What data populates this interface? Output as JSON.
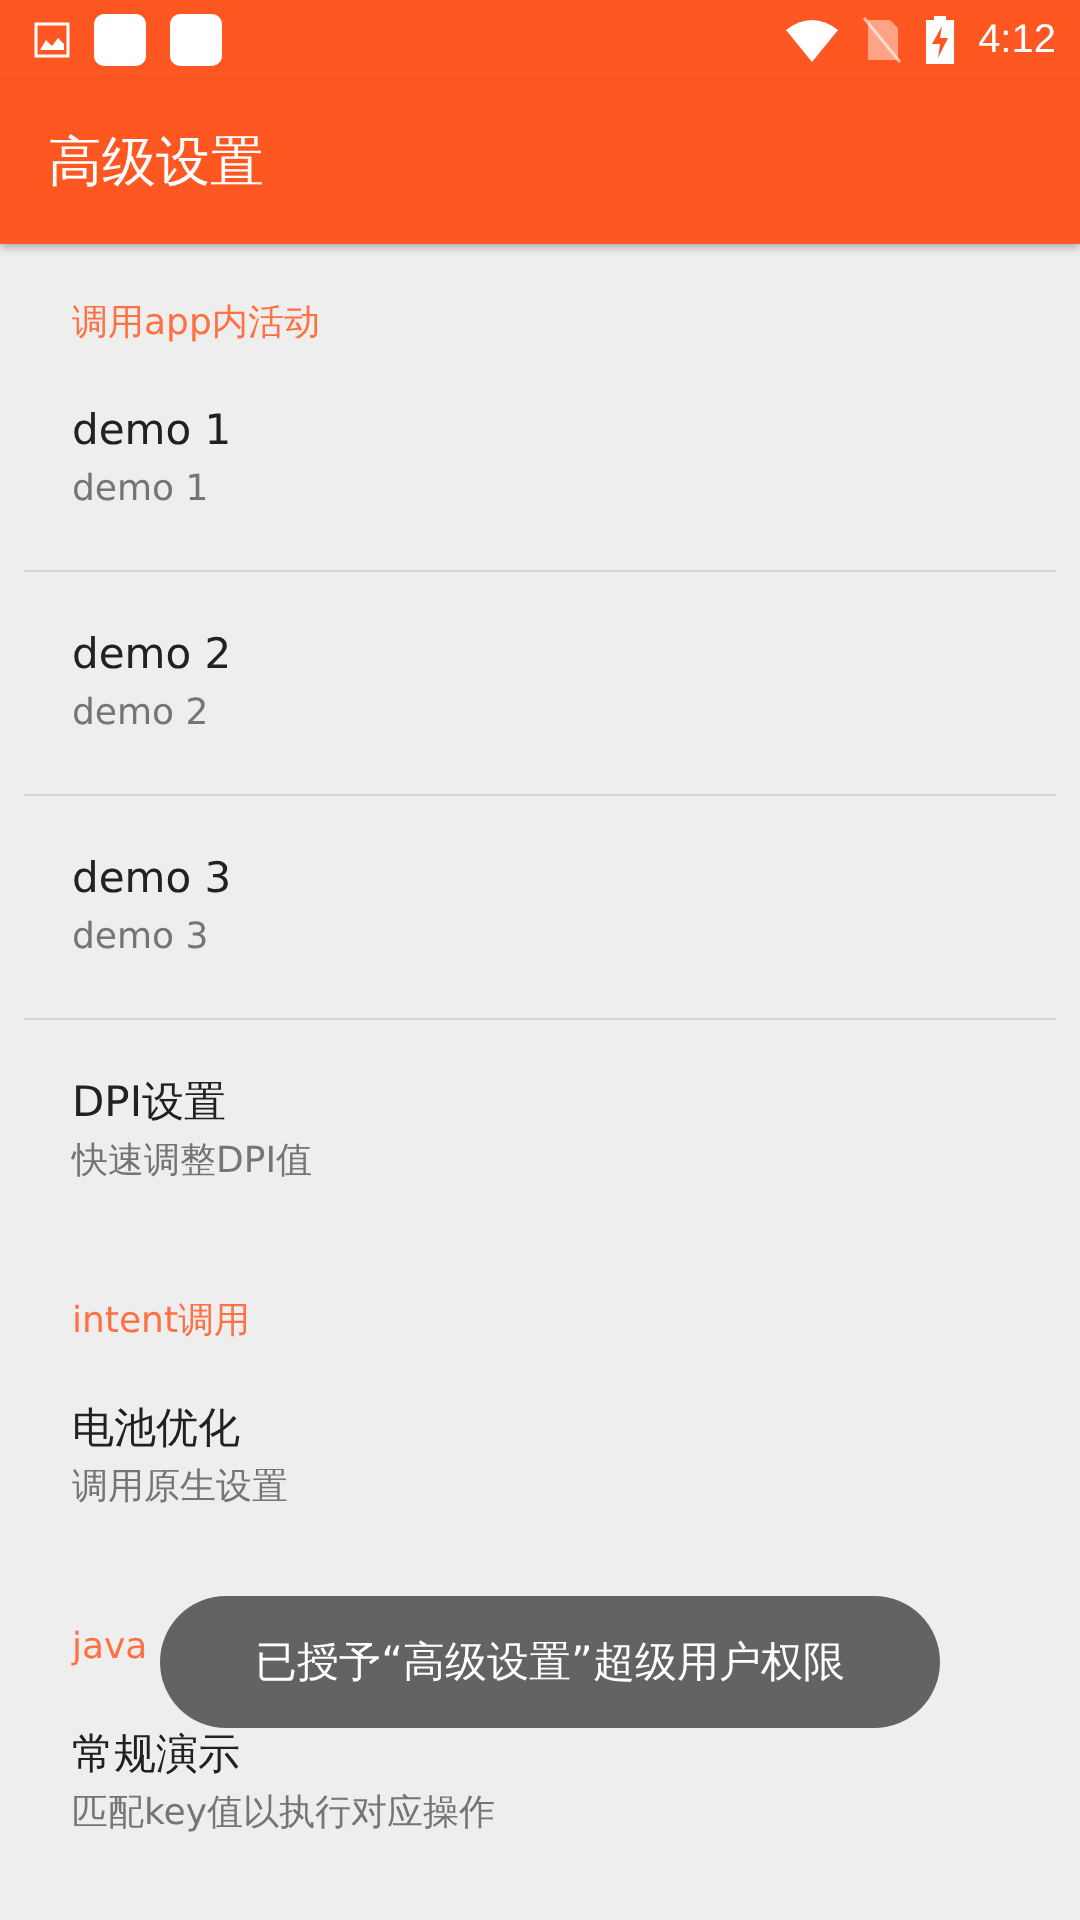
{
  "status_bar": {
    "time": "4:12"
  },
  "toolbar": {
    "title": "高级设置"
  },
  "sections": [
    {
      "header": "调用app内活动",
      "items": [
        {
          "title": "demo 1",
          "summary": "demo 1"
        },
        {
          "title": "demo 2",
          "summary": "demo 2"
        },
        {
          "title": "demo 3",
          "summary": "demo 3"
        },
        {
          "title": "DPI设置",
          "summary": "快速调整DPI值"
        }
      ]
    },
    {
      "header": "intent调用",
      "items": [
        {
          "title": "电池优化",
          "summary": "调用原生设置"
        }
      ]
    },
    {
      "header": "java",
      "items": [
        {
          "title": "常规演示",
          "summary": "匹配key值以执行对应操作"
        }
      ]
    }
  ],
  "toast": {
    "text": "已授予“高级设置”超级用户权限"
  }
}
